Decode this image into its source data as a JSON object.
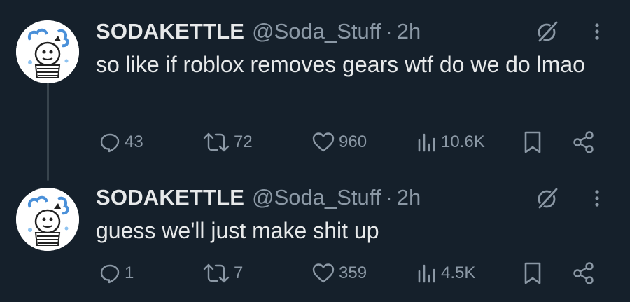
{
  "colors": {
    "background": "#15202b",
    "text_primary": "#e7e9ea",
    "text_secondary": "#8b98a5",
    "thread_line": "#38444d"
  },
  "tweets": [
    {
      "name": "SODAKETTLE",
      "handle": "@Soda_Stuff",
      "separator": "·",
      "time": "2h",
      "text": "so like if roblox removes gears wtf do we do lmao",
      "reply_count": "43",
      "retweet_count": "72",
      "like_count": "960",
      "view_count": "10.6K",
      "icons": [
        "grok-icon",
        "more-icon",
        "reply-icon",
        "retweet-icon",
        "like-icon",
        "views-icon",
        "bookmark-icon",
        "share-icon"
      ]
    },
    {
      "name": "SODAKETTLE",
      "handle": "@Soda_Stuff",
      "separator": "·",
      "time": "2h",
      "text": "guess we'll just make shit up",
      "reply_count": "1",
      "retweet_count": "7",
      "like_count": "359",
      "view_count": "4.5K",
      "icons": [
        "grok-icon",
        "more-icon",
        "reply-icon",
        "retweet-icon",
        "like-icon",
        "views-icon",
        "bookmark-icon",
        "share-icon"
      ]
    }
  ]
}
